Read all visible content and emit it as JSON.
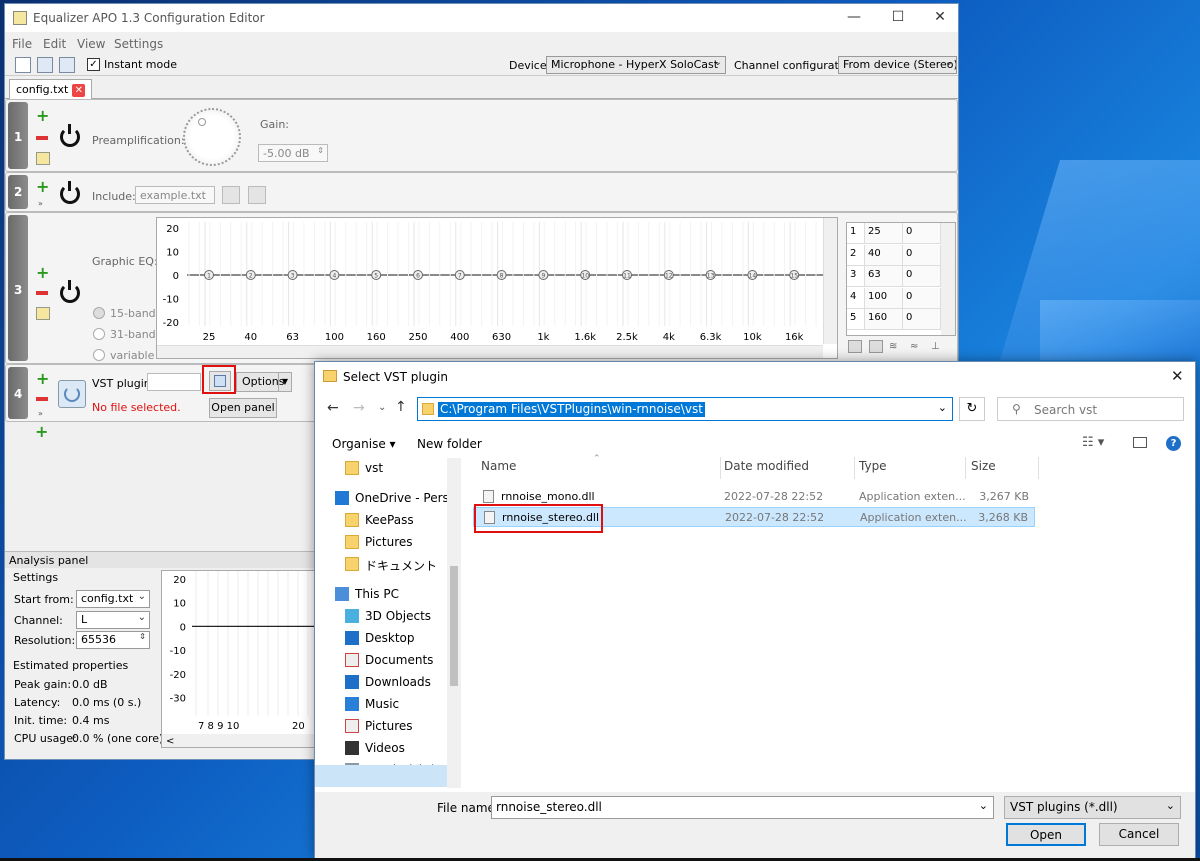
{
  "main_window": {
    "title": "Equalizer APO 1.3 Configuration Editor",
    "menu": [
      "File",
      "Edit",
      "View",
      "Settings"
    ],
    "instant_mode_label": "Instant mode",
    "instant_mode_checked": true,
    "device_label": "Device:",
    "device_value": "Microphone - HyperX SoloCast",
    "channel_config_label": "Channel configuration:",
    "channel_config_value": "From device (Stereo)",
    "tab_label": "config.txt",
    "rows": [
      {
        "num": "1",
        "preamp_label": "Preamplification:",
        "gain_label": "Gain:",
        "gain_value": "-5.00 dB"
      },
      {
        "num": "2",
        "include_label": "Include:",
        "include_value": "example.txt"
      },
      {
        "num": "3",
        "geq_label": "Graphic EQ:",
        "radio_options": [
          "15-band",
          "31-band",
          "variable"
        ],
        "radio_selected": "15-band"
      },
      {
        "num": "4",
        "vst_label": "VST plugin:",
        "no_file": "No file selected.",
        "options_label": "Options",
        "open_panel_label": "Open panel"
      }
    ]
  },
  "eq_chart": {
    "y_ticks": [
      "20",
      "10",
      "0",
      "-10",
      "-20"
    ],
    "x_ticks": [
      "25",
      "40",
      "63",
      "100",
      "160",
      "250",
      "400",
      "630",
      "1k",
      "1.6k",
      "2.5k",
      "4k",
      "6.3k",
      "10k",
      "16k"
    ],
    "band_ids": [
      "1",
      "2",
      "3",
      "4",
      "5",
      "6",
      "7",
      "8",
      "9",
      "10",
      "11",
      "12",
      "13",
      "14",
      "15"
    ]
  },
  "band_table": [
    {
      "i": "1",
      "f": "25",
      "g": "0"
    },
    {
      "i": "2",
      "f": "40",
      "g": "0"
    },
    {
      "i": "3",
      "f": "63",
      "g": "0"
    },
    {
      "i": "4",
      "f": "100",
      "g": "0"
    },
    {
      "i": "5",
      "f": "160",
      "g": "0"
    }
  ],
  "analysis": {
    "panel_title": "Analysis panel",
    "settings_title": "Settings",
    "start_from_label": "Start from:",
    "start_from_value": "config.txt",
    "channel_label": "Channel:",
    "channel_value": "L",
    "resolution_label": "Resolution:",
    "resolution_value": "65536",
    "est_title": "Estimated properties",
    "props": [
      {
        "k": "Peak gain:",
        "v": "0.0 dB"
      },
      {
        "k": "Latency:",
        "v": "0.0 ms (0 s.)"
      },
      {
        "k": "Init. time:",
        "v": "0.4 ms"
      },
      {
        "k": "CPU usage:",
        "v": "0.0 % (one core)"
      }
    ],
    "y_ticks": [
      "20",
      "10",
      "0",
      "-10",
      "-20",
      "-30"
    ],
    "x_ticks": [
      "7 8 9 10",
      "20"
    ]
  },
  "dialog": {
    "title": "Select VST plugin",
    "address": "C:\\Program Files\\VSTPlugins\\win-rnnoise\\vst",
    "search_placeholder": "Search vst",
    "organise_label": "Organise ▾",
    "new_folder_label": "New folder",
    "nav": [
      {
        "label": "vst",
        "icon": "folder-icon"
      },
      {
        "label": "OneDrive - Person",
        "icon": "cloud-icon"
      },
      {
        "label": "KeePass",
        "icon": "folder-icon"
      },
      {
        "label": "Pictures",
        "icon": "folder-icon"
      },
      {
        "label": "ドキュメント",
        "icon": "folder-icon"
      },
      {
        "label": "This PC",
        "icon": "computer-icon"
      },
      {
        "label": "3D Objects",
        "icon": "cube-icon"
      },
      {
        "label": "Desktop",
        "icon": "desktop-icon"
      },
      {
        "label": "Documents",
        "icon": "document-icon"
      },
      {
        "label": "Downloads",
        "icon": "download-icon"
      },
      {
        "label": "Music",
        "icon": "music-icon"
      },
      {
        "label": "Pictures",
        "icon": "pictures-icon"
      },
      {
        "label": "Videos",
        "icon": "video-icon"
      },
      {
        "label": "Local Disk (C:)",
        "icon": "drive-icon"
      }
    ],
    "columns": [
      "Name",
      "Date modified",
      "Type",
      "Size"
    ],
    "files": [
      {
        "name": "rnnoise_mono.dll",
        "date": "2022-07-28 22:52",
        "type": "Application exten...",
        "size": "3,267 KB",
        "selected": false
      },
      {
        "name": "rnnoise_stereo.dll",
        "date": "2022-07-28 22:52",
        "type": "Application exten...",
        "size": "3,268 KB",
        "selected": true
      }
    ],
    "file_name_label": "File name:",
    "file_name_value": "rnnoise_stereo.dll",
    "filter_value": "VST plugins (*.dll)",
    "open_label": "Open",
    "cancel_label": "Cancel"
  }
}
